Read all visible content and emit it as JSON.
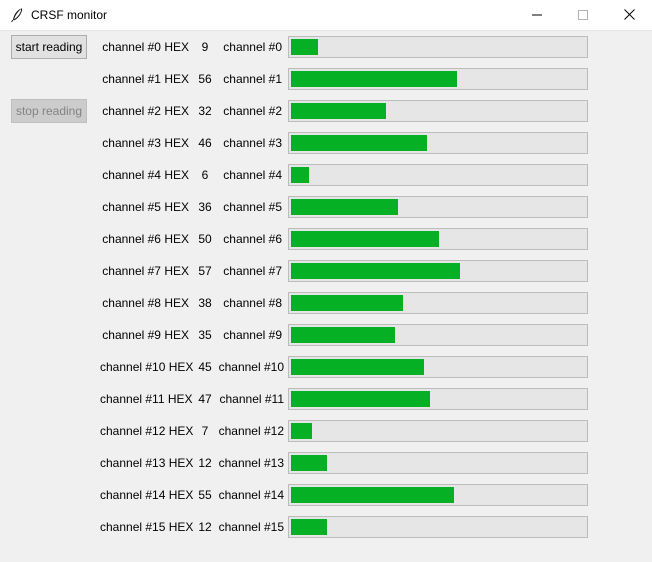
{
  "window": {
    "title": "CRSF monitor",
    "icon": "feather-icon",
    "controls": [
      "minimize-icon",
      "maximize-icon",
      "close-icon"
    ]
  },
  "buttons": {
    "start": "start reading",
    "stop": "stop reading",
    "stop_disabled": true
  },
  "colors": {
    "bar_fill": "#06b025",
    "bar_trough": "#e6e6e6"
  },
  "progress_max": 100,
  "channels": [
    {
      "hex_label": "channel #0 HEX",
      "hex": "9",
      "name": "channel #0",
      "value": 9
    },
    {
      "hex_label": "channel #1 HEX",
      "hex": "56",
      "name": "channel #1",
      "value": 56
    },
    {
      "hex_label": "channel #2 HEX",
      "hex": "32",
      "name": "channel #2",
      "value": 32
    },
    {
      "hex_label": "channel #3 HEX",
      "hex": "46",
      "name": "channel #3",
      "value": 46
    },
    {
      "hex_label": "channel #4 HEX",
      "hex": "6",
      "name": "channel #4",
      "value": 6
    },
    {
      "hex_label": "channel #5 HEX",
      "hex": "36",
      "name": "channel #5",
      "value": 36
    },
    {
      "hex_label": "channel #6 HEX",
      "hex": "50",
      "name": "channel #6",
      "value": 50
    },
    {
      "hex_label": "channel #7 HEX",
      "hex": "57",
      "name": "channel #7",
      "value": 57
    },
    {
      "hex_label": "channel #8 HEX",
      "hex": "38",
      "name": "channel #8",
      "value": 38
    },
    {
      "hex_label": "channel #9 HEX",
      "hex": "35",
      "name": "channel #9",
      "value": 35
    },
    {
      "hex_label": "channel #10 HEX",
      "hex": "45",
      "name": "channel #10",
      "value": 45
    },
    {
      "hex_label": "channel #11 HEX",
      "hex": "47",
      "name": "channel #11",
      "value": 47
    },
    {
      "hex_label": "channel #12 HEX",
      "hex": "7",
      "name": "channel #12",
      "value": 7
    },
    {
      "hex_label": "channel #13 HEX",
      "hex": "12",
      "name": "channel #13",
      "value": 12
    },
    {
      "hex_label": "channel #14 HEX",
      "hex": "55",
      "name": "channel #14",
      "value": 55
    },
    {
      "hex_label": "channel #15 HEX",
      "hex": "12",
      "name": "channel #15",
      "value": 12
    }
  ]
}
